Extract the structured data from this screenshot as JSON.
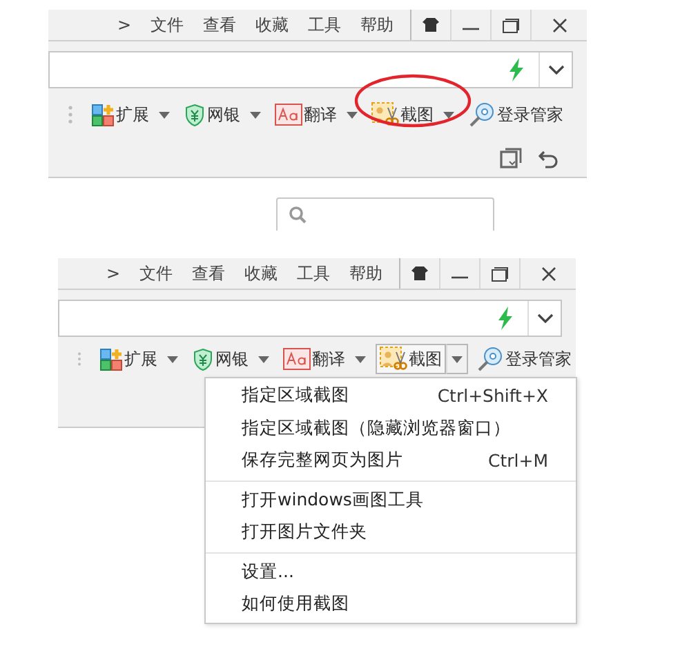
{
  "screens": [
    {
      "menu_bar": [
        ">",
        "文件",
        "查看",
        "收藏",
        "工具",
        "帮助"
      ],
      "toolbar": [
        {
          "kind": "extensions",
          "label": "扩展",
          "dropdown": true,
          "circled": false,
          "pressed": false
        },
        {
          "kind": "bank",
          "label": "网银",
          "dropdown": true,
          "circled": false,
          "pressed": false
        },
        {
          "kind": "translate",
          "label": "翻译",
          "dropdown": true,
          "circled": false,
          "pressed": false
        },
        {
          "kind": "screenshot",
          "label": "截图",
          "dropdown": true,
          "circled": true,
          "pressed": false
        },
        {
          "kind": "login",
          "label": "登录管家",
          "dropdown": false,
          "circled": false,
          "pressed": false
        }
      ],
      "second_row": true
    },
    {
      "menu_bar": [
        ">",
        "文件",
        "查看",
        "收藏",
        "工具",
        "帮助"
      ],
      "toolbar": [
        {
          "kind": "extensions",
          "label": "扩展",
          "dropdown": true,
          "circled": false,
          "pressed": false
        },
        {
          "kind": "bank",
          "label": "网银",
          "dropdown": true,
          "circled": false,
          "pressed": false
        },
        {
          "kind": "translate",
          "label": "翻译",
          "dropdown": true,
          "circled": false,
          "pressed": false
        },
        {
          "kind": "screenshot",
          "label": "截图",
          "dropdown": true,
          "circled": false,
          "pressed": true
        },
        {
          "kind": "login",
          "label": "登录管家",
          "dropdown": false,
          "circled": false,
          "pressed": false
        }
      ],
      "dropdown_menu": [
        [
          {
            "label": "指定区域截图",
            "shortcut": "Ctrl+Shift+X"
          },
          {
            "label": "指定区域截图（隐藏浏览器窗口）"
          },
          {
            "label": "保存完整网页为图片",
            "shortcut": "Ctrl+M"
          }
        ],
        [
          {
            "label": "打开windows画图工具"
          },
          {
            "label": "打开图片文件夹"
          }
        ],
        [
          {
            "label": "设置..."
          },
          {
            "label": "如何使用截图"
          }
        ]
      ]
    }
  ]
}
